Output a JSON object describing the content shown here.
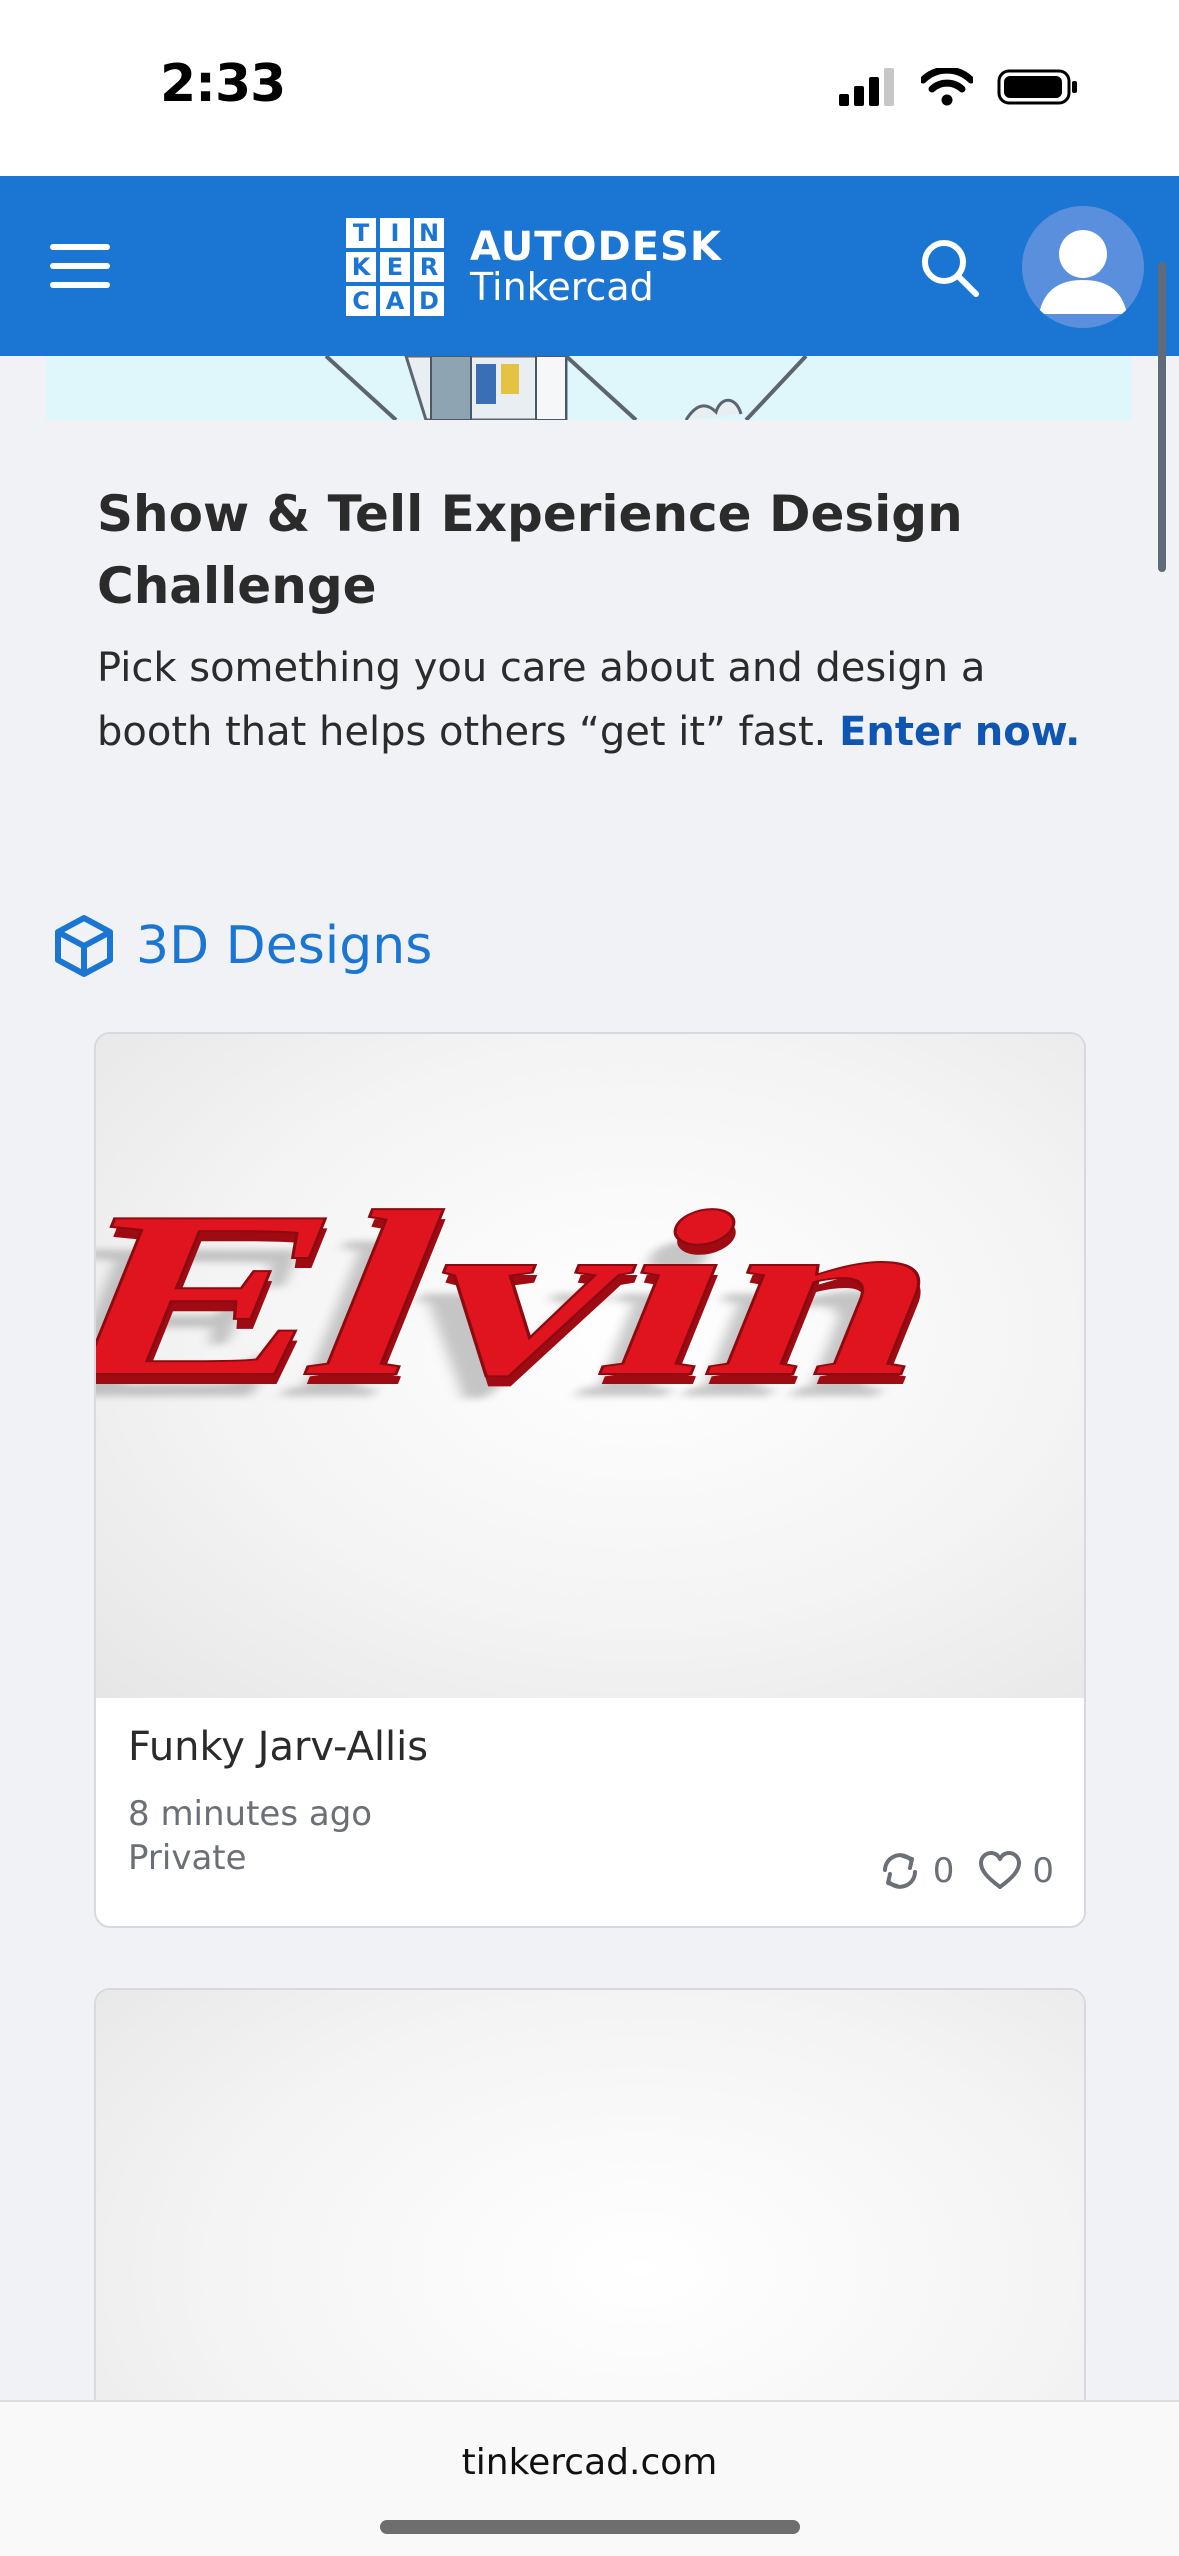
{
  "status_bar": {
    "time": "2:33"
  },
  "header": {
    "menu_icon": "hamburger-menu-icon",
    "logo_grid": [
      "T",
      "I",
      "N",
      "K",
      "E",
      "R",
      "C",
      "A",
      "D"
    ],
    "brand_line1": "AUTODESK",
    "brand_line2": "Tinkercad",
    "search_icon": "search-icon",
    "avatar_icon": "user-avatar-icon",
    "accent_color": "#1b76d3"
  },
  "challenge": {
    "title": "Show & Tell Experience Design Challenge",
    "description": "Pick something you care about and design a booth that helps others “get it” fast.",
    "link_label": "Enter now."
  },
  "section": {
    "icon": "cube-icon",
    "title": "3D Designs"
  },
  "designs": [
    {
      "title": "Funky Jarv-Allis",
      "time": "8 minutes ago",
      "visibility": "Private",
      "remixes": "0",
      "likes": "0",
      "thumbnail_text": "Elvin",
      "thumbnail_color": "#e0141e"
    }
  ],
  "browser": {
    "url": "tinkercad.com"
  }
}
